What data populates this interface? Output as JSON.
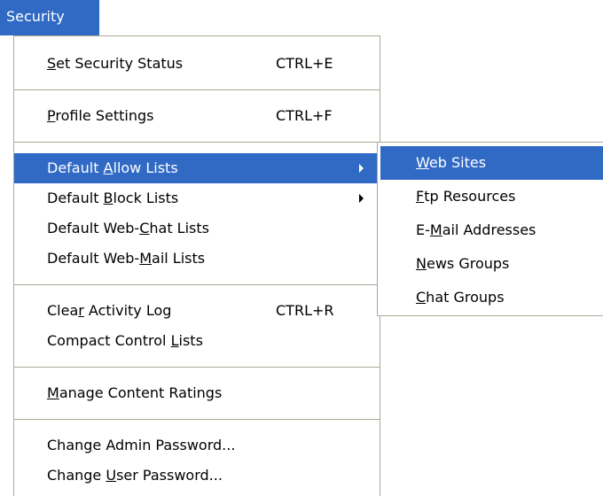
{
  "menubar": {
    "label": "Security"
  },
  "main_menu": {
    "groups": [
      [
        {
          "pre": "",
          "acc": "S",
          "post": "et Security Status",
          "shortcut": "CTRL+E"
        }
      ],
      [
        {
          "pre": "",
          "acc": "P",
          "post": "rofile Settings",
          "shortcut": "CTRL+F"
        }
      ],
      [
        {
          "pre": "Default ",
          "acc": "A",
          "post": "llow Lists",
          "submenu": true,
          "selected": true
        },
        {
          "pre": "Default ",
          "acc": "B",
          "post": "lock Lists",
          "submenu": true
        },
        {
          "pre": "Default Web-",
          "acc": "C",
          "post": "hat Lists"
        },
        {
          "pre": "Default Web-",
          "acc": "M",
          "post": "ail Lists"
        }
      ],
      [
        {
          "pre": "Clea",
          "acc": "r",
          "post": " Activity Log",
          "shortcut": "CTRL+R"
        },
        {
          "pre": "Compact Control ",
          "acc": "L",
          "post": "ists"
        }
      ],
      [
        {
          "pre": "",
          "acc": "M",
          "post": "anage Content Ratings"
        }
      ],
      [
        {
          "pre": "Chan",
          "acc": "g",
          "post": "e Admin Password..."
        },
        {
          "pre": "Change ",
          "acc": "U",
          "post": "ser Password..."
        }
      ]
    ]
  },
  "sub_menu": {
    "items": [
      {
        "pre": "",
        "acc": "W",
        "post": "eb Sites",
        "selected": true
      },
      {
        "pre": "",
        "acc": "F",
        "post": "tp Resources"
      },
      {
        "pre": "E-",
        "acc": "M",
        "post": "ail Addresses"
      },
      {
        "pre": "",
        "acc": "N",
        "post": "ews Groups"
      },
      {
        "pre": "",
        "acc": "C",
        "post": "hat Groups"
      }
    ]
  },
  "colors": {
    "highlight": "#316ac5",
    "border": "#aca899"
  }
}
